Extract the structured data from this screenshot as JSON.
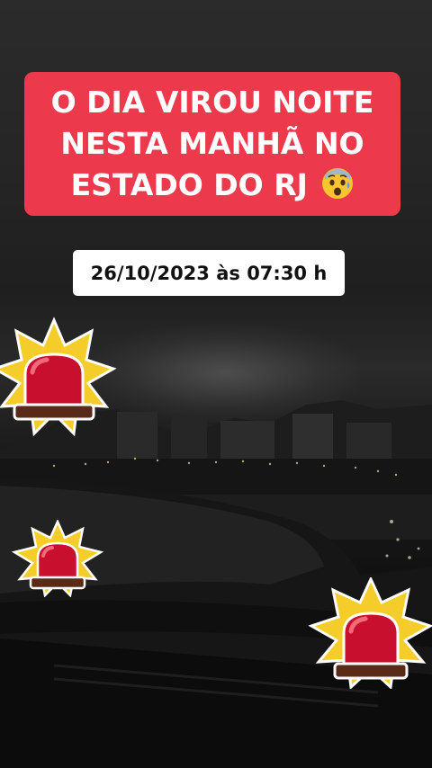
{
  "headline": {
    "text": "O DIA  VIROU NOITE NESTA MANHÃ NO ESTADO DO RJ",
    "emoji": "anxious-face-with-sweat-emoji",
    "background_color": "#ec3a4c",
    "text_color": "#ffffff"
  },
  "date_stamp": {
    "text": "26/10/2023 às 07:30 h",
    "background_color": "#ffffff"
  },
  "stickers": [
    {
      "icon": "police-siren-icon"
    },
    {
      "icon": "police-siren-icon"
    },
    {
      "icon": "police-siren-icon"
    }
  ],
  "colors": {
    "siren_red": "#c8102e",
    "burst_yellow": "#f5cd2a",
    "siren_base": "#5a2a18"
  }
}
